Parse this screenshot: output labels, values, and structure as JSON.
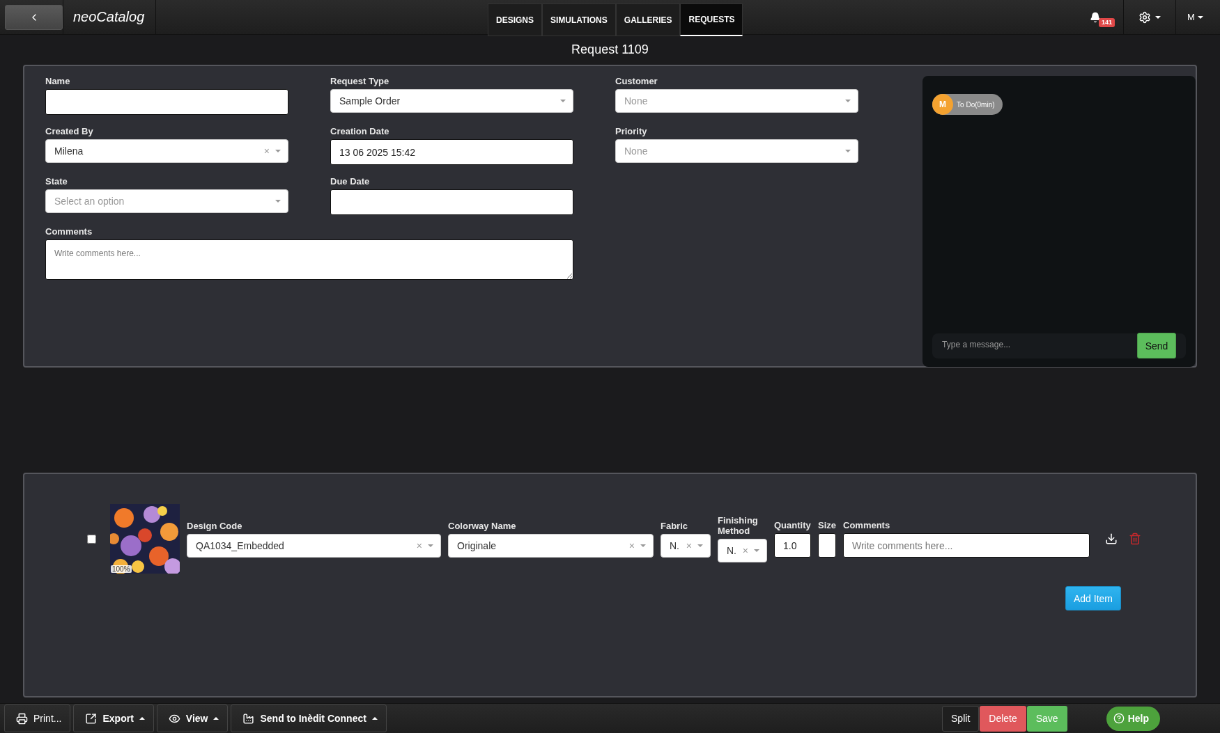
{
  "app": {
    "logo": "neoCatalog"
  },
  "nav_tabs": [
    {
      "label": "DESIGNS",
      "selected": false
    },
    {
      "label": "SIMULATIONS",
      "selected": false
    },
    {
      "label": "GALLERIES",
      "selected": false
    },
    {
      "label": "REQUESTS",
      "selected": true
    }
  ],
  "notifications": {
    "count": "141"
  },
  "user": {
    "initial": "M"
  },
  "title": "Request 1109",
  "form": {
    "fields": [
      {
        "label": "Name",
        "kind": "text"
      },
      {
        "label": "Request Type",
        "kind": "select",
        "value": "Sample Order"
      },
      {
        "label": "Customer",
        "kind": "select",
        "placeholder": "None"
      },
      {
        "label": "Created By",
        "kind": "select",
        "value": "Milena",
        "clear": "×"
      },
      {
        "label": "Creation Date",
        "kind": "text",
        "value": "13 06 2025 15:42"
      },
      {
        "label": "Priority",
        "kind": "select",
        "placeholder": "None"
      },
      {
        "label": "State",
        "kind": "select",
        "placeholder": "Select an option"
      },
      {
        "label": "Due Date",
        "kind": "text"
      },
      {
        "label": "Comments",
        "kind": "textarea",
        "placeholder": "Write comments here..."
      }
    ]
  },
  "chat": {
    "status_initial": "M",
    "status_text": "To Do(0min)",
    "placeholder": "Type a message...",
    "send": "Send"
  },
  "items": [
    {
      "checked": false,
      "zoom": "100%",
      "cells": [
        {
          "label": "Design Code",
          "kind": "select",
          "value": "QA1034_Embedded",
          "clear": "×"
        },
        {
          "label": "Colorway Name",
          "kind": "select",
          "value": "Originale",
          "clear": "×"
        },
        {
          "label": "Fabric",
          "kind": "select",
          "value": "N.",
          "clear": "×"
        },
        {
          "label": "Finishing Method",
          "kind": "select",
          "value": "N.",
          "clear": "×"
        },
        {
          "label": "Quantity",
          "kind": "text",
          "value": "1.0"
        },
        {
          "label": "Size",
          "kind": "text"
        },
        {
          "label": "Comments",
          "kind": "text",
          "placeholder": "Write comments here..."
        }
      ]
    }
  ],
  "add_item": "Add Item",
  "toolbar": [
    {
      "label": "Print...",
      "kind": "print",
      "menu": false
    },
    {
      "label": "Export",
      "kind": "export",
      "menu": true
    },
    {
      "label": "View",
      "kind": "view",
      "menu": true
    },
    {
      "label": "Send to Inèdit Connect",
      "kind": "send",
      "menu": true
    }
  ],
  "actions": [
    {
      "label": "Split",
      "kind": "default"
    },
    {
      "label": "Delete",
      "kind": "danger"
    },
    {
      "label": "Save",
      "kind": "success"
    }
  ],
  "help": "Help"
}
